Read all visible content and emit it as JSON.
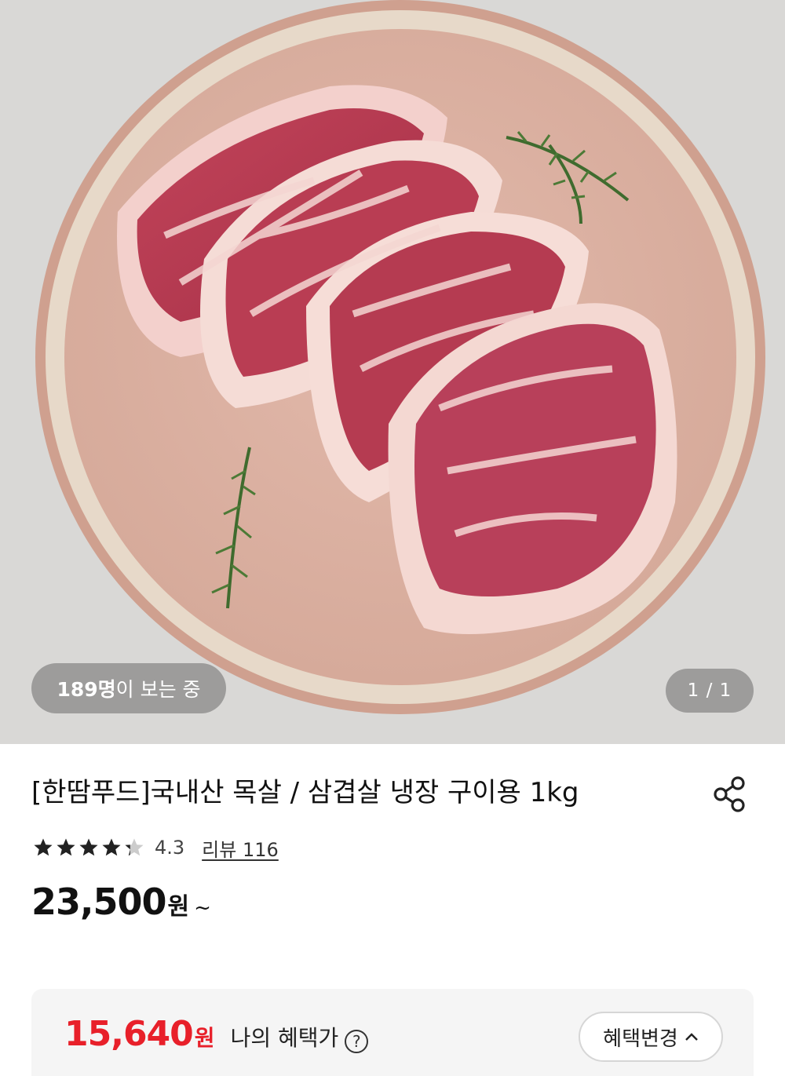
{
  "gallery": {
    "viewers_count": "189명",
    "viewers_suffix": "이 보는 중",
    "pager": "1 / 1"
  },
  "product": {
    "title": "[한땀푸드]국내산 목살 / 삼겹살 냉장 구이용 1kg",
    "rating": 4.3,
    "rating_text": "4.3",
    "review_link": "리뷰 116",
    "price": "23,500",
    "price_unit": "원",
    "price_suffix": "~"
  },
  "benefit": {
    "price": "15,640",
    "price_unit": "원",
    "label": "나의 혜택가",
    "help": "?",
    "change_button": "혜택변경"
  },
  "colors": {
    "accent_red": "#e8202a",
    "star": "#222222",
    "star_empty": "#cccccc"
  },
  "icons": {
    "share": "share-icon",
    "star": "star-icon",
    "help": "question-circle-icon",
    "chevron": "chevron-up-icon"
  }
}
